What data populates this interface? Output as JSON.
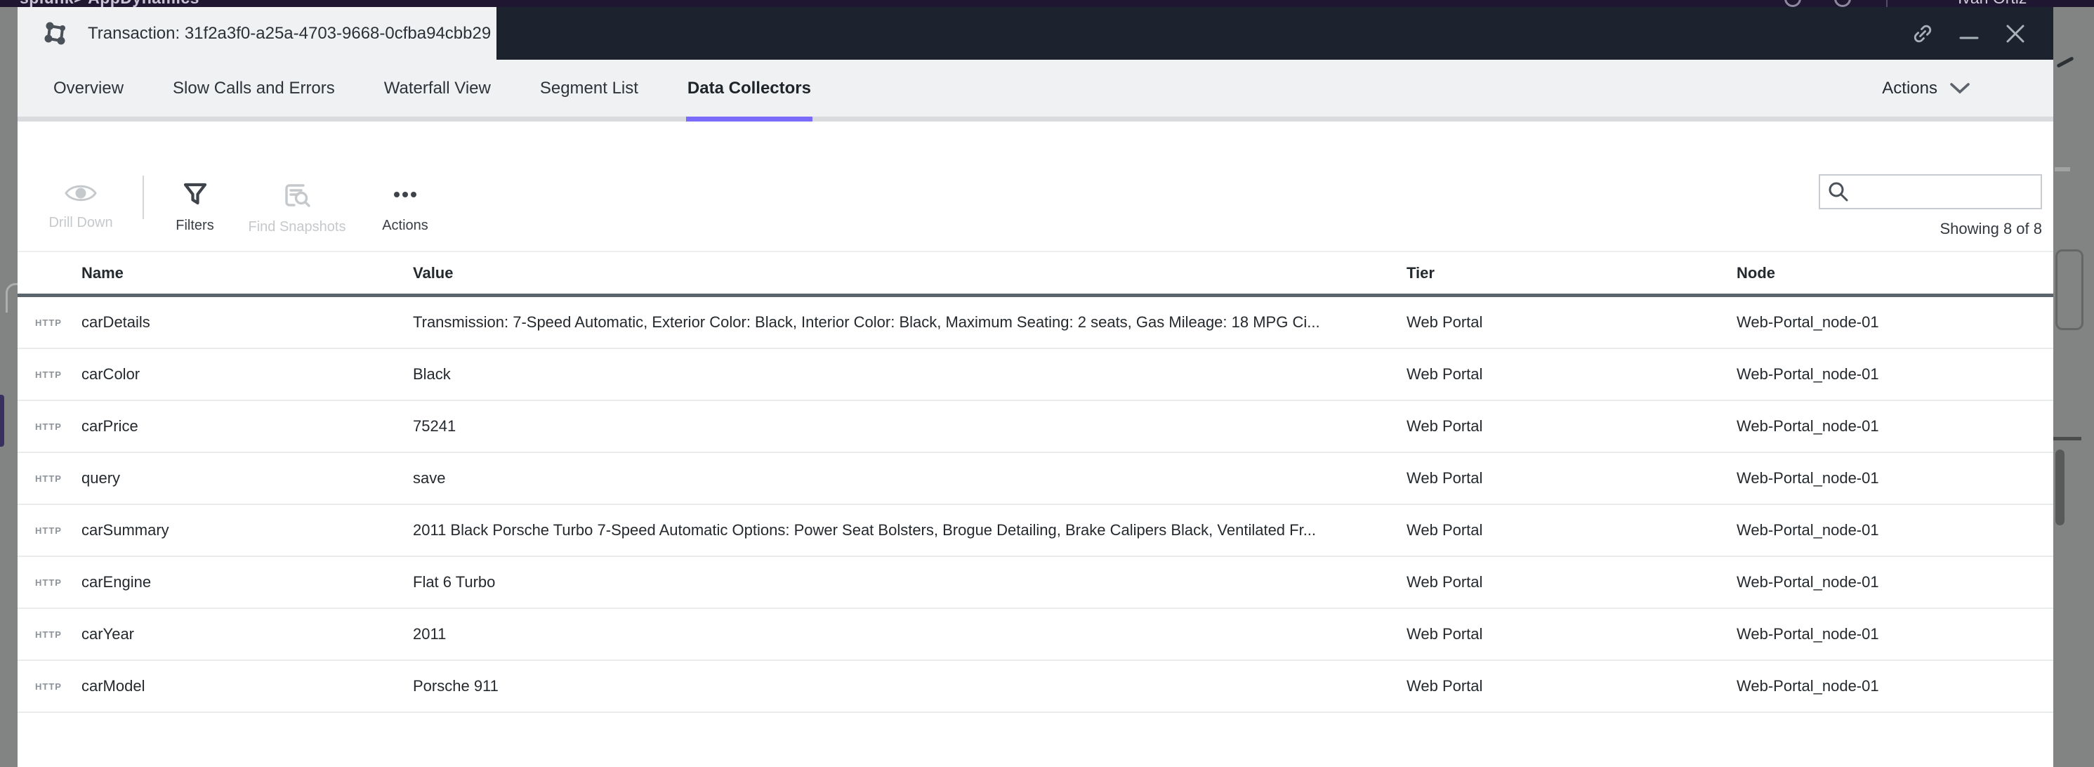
{
  "underlying_page": {
    "brand": "splunk> AppDynamics",
    "user": "Ivan Ortiz"
  },
  "window": {
    "title": "Transaction: 31f2a3f0-a25a-4703-9668-0cfba94cbb29"
  },
  "tabs": [
    {
      "label": "Overview"
    },
    {
      "label": "Slow Calls and Errors"
    },
    {
      "label": "Waterfall View"
    },
    {
      "label": "Segment List"
    },
    {
      "label": "Data Collectors",
      "active": true
    }
  ],
  "actions_menu": {
    "label": "Actions"
  },
  "toolbar": {
    "drill_down_label": "Drill Down",
    "filters_label": "Filters",
    "find_snapshots_label": "Find Snapshots",
    "actions_label": "Actions",
    "search_placeholder": "",
    "showing_text": "Showing 8 of 8"
  },
  "table": {
    "columns": [
      "Name",
      "Value",
      "Tier",
      "Node"
    ],
    "rows": [
      {
        "protocol": "HTTP",
        "name": "carDetails",
        "value": "Transmission: 7-Speed Automatic, Exterior Color: Black, Interior Color: Black, Maximum Seating: 2 seats, Gas Mileage: 18 MPG Ci...",
        "tier": "Web Portal",
        "node": "Web-Portal_node-01"
      },
      {
        "protocol": "HTTP",
        "name": "carColor",
        "value": "Black",
        "tier": "Web Portal",
        "node": "Web-Portal_node-01"
      },
      {
        "protocol": "HTTP",
        "name": "carPrice",
        "value": "75241",
        "tier": "Web Portal",
        "node": "Web-Portal_node-01"
      },
      {
        "protocol": "HTTP",
        "name": "query",
        "value": "save",
        "tier": "Web Portal",
        "node": "Web-Portal_node-01"
      },
      {
        "protocol": "HTTP",
        "name": "carSummary",
        "value": "2011 Black Porsche Turbo 7-Speed Automatic Options: Power Seat Bolsters, Brogue Detailing, Brake Calipers Black, Ventilated Fr...",
        "tier": "Web Portal",
        "node": "Web-Portal_node-01"
      },
      {
        "protocol": "HTTP",
        "name": "carEngine",
        "value": "Flat 6 Turbo",
        "tier": "Web Portal",
        "node": "Web-Portal_node-01"
      },
      {
        "protocol": "HTTP",
        "name": "carYear",
        "value": "2011",
        "tier": "Web Portal",
        "node": "Web-Portal_node-01"
      },
      {
        "protocol": "HTTP",
        "name": "carModel",
        "value": "Porsche 911",
        "tier": "Web Portal",
        "node": "Web-Portal_node-01"
      }
    ]
  },
  "colors": {
    "accent": "#7a6bf8",
    "titlebar": "#1c232e",
    "page_header": "#1f1631",
    "header_border": "#5c646b"
  }
}
